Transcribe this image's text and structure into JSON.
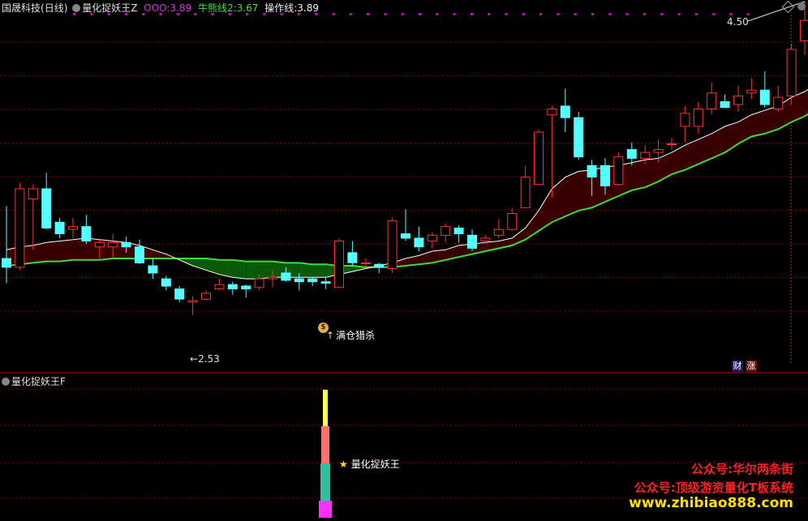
{
  "main_panel": {
    "stock_name": "国晟科技",
    "period": "(日线)",
    "indicator_name": "量化捉妖王Z",
    "line_ooo_label": "OOO:",
    "line_ooo_value": "3.89",
    "line_bull2_label": "牛熊线2:",
    "line_bull2_value": "3.67",
    "line_op_label": "操作线:",
    "line_op_value": "3.89",
    "high_label": "4.50",
    "low_label": "2.53",
    "signal_text": "满仓猎杀",
    "signal_icon": "money-bag-icon",
    "badge_cai": "财",
    "badge_zhang": "涨",
    "colors": {
      "up": "#ff3232",
      "down": "#54ffff",
      "ma_white": "#ffffff",
      "ma_green": "#3cdc3c",
      "fill_red": "#3a0000",
      "fill_green": "#0a5a0a",
      "grid": "#8b0000",
      "magenta": "#d000d0"
    }
  },
  "sub_panel": {
    "indicator_name": "量化捉妖王F",
    "signal_text": "量化捉妖王",
    "signal_icon": "star-icon"
  },
  "watermarks": {
    "line1": "公众号:华尔两条街",
    "line2": "公众号:顶级游资量化T板系统",
    "line3": "www.zhibiao888.com"
  },
  "chart_data": {
    "type": "candlestick",
    "ylim": [
      2.2,
      4.6
    ],
    "grid": true,
    "candles": [
      [
        2.92,
        2.86,
        3.28,
        2.75
      ],
      [
        2.86,
        3.4,
        3.44,
        2.84
      ],
      [
        3.33,
        3.4,
        3.43,
        2.98
      ],
      [
        3.4,
        3.13,
        3.51,
        3.12
      ],
      [
        3.17,
        3.09,
        3.2,
        3.06
      ],
      [
        3.12,
        3.14,
        3.2,
        3.06
      ],
      [
        3.14,
        3.04,
        3.22,
        3.02
      ],
      [
        3.0,
        3.03,
        3.05,
        2.92
      ],
      [
        3.0,
        3.03,
        3.09,
        2.92
      ],
      [
        3.03,
        3.0,
        3.07,
        2.96
      ],
      [
        3.0,
        2.89,
        3.05,
        2.88
      ],
      [
        2.87,
        2.82,
        2.92,
        2.78
      ],
      [
        2.78,
        2.73,
        2.8,
        2.7
      ],
      [
        2.71,
        2.64,
        2.73,
        2.62
      ],
      [
        2.62,
        2.63,
        2.66,
        2.53
      ],
      [
        2.64,
        2.68,
        2.7,
        2.63
      ],
      [
        2.71,
        2.74,
        2.78,
        2.7
      ],
      [
        2.74,
        2.71,
        2.76,
        2.67
      ],
      [
        2.73,
        2.71,
        2.74,
        2.65
      ],
      [
        2.72,
        2.78,
        2.81,
        2.7
      ],
      [
        2.78,
        2.79,
        2.84,
        2.72
      ],
      [
        2.82,
        2.77,
        2.86,
        2.76
      ],
      [
        2.78,
        2.76,
        2.82,
        2.7
      ],
      [
        2.78,
        2.76,
        2.79,
        2.73
      ],
      [
        2.76,
        2.75,
        2.79,
        2.71
      ],
      [
        2.72,
        3.04,
        3.06,
        2.72
      ],
      [
        2.96,
        2.89,
        3.04,
        2.87
      ],
      [
        2.89,
        2.89,
        2.92,
        2.86
      ],
      [
        2.88,
        2.86,
        2.89,
        2.82
      ],
      [
        2.85,
        3.18,
        3.2,
        2.82
      ],
      [
        3.09,
        3.06,
        3.26,
        3.04
      ],
      [
        3.06,
        3.0,
        3.14,
        2.97
      ],
      [
        3.04,
        3.08,
        3.1,
        2.99
      ],
      [
        3.08,
        3.14,
        3.16,
        3.03
      ],
      [
        3.13,
        3.09,
        3.15,
        3.03
      ],
      [
        3.08,
        2.99,
        3.12,
        2.97
      ],
      [
        3.04,
        3.06,
        3.08,
        3.02
      ],
      [
        3.08,
        3.12,
        3.19,
        3.06
      ],
      [
        3.12,
        3.23,
        3.27,
        3.11
      ],
      [
        3.27,
        3.48,
        3.56,
        3.27
      ],
      [
        3.43,
        3.79,
        3.81,
        3.43
      ],
      [
        3.91,
        3.95,
        3.97,
        3.34
      ],
      [
        3.97,
        3.89,
        4.09,
        3.79
      ],
      [
        3.89,
        3.62,
        3.93,
        3.6
      ],
      [
        3.56,
        3.48,
        3.6,
        3.35
      ],
      [
        3.56,
        3.42,
        3.61,
        3.36
      ],
      [
        3.43,
        3.62,
        3.65,
        3.42
      ],
      [
        3.67,
        3.61,
        3.72,
        3.56
      ],
      [
        3.61,
        3.65,
        3.7,
        3.57
      ],
      [
        3.65,
        3.67,
        3.74,
        3.58
      ],
      [
        3.71,
        3.71,
        3.75,
        3.67
      ],
      [
        3.83,
        3.92,
        3.97,
        3.72
      ],
      [
        3.83,
        3.95,
        4.0,
        3.78
      ],
      [
        3.95,
        4.06,
        4.13,
        3.91
      ],
      [
        4.0,
        3.96,
        4.05,
        3.96
      ],
      [
        3.98,
        4.04,
        4.11,
        3.93
      ],
      [
        4.06,
        4.08,
        4.16,
        4.02
      ],
      [
        4.08,
        3.98,
        4.21,
        3.96
      ],
      [
        3.95,
        4.03,
        4.11,
        3.93
      ],
      [
        4.04,
        4.36,
        4.4,
        3.98
      ],
      [
        4.42,
        4.56,
        4.69,
        4.32
      ],
      [
        4.27,
        4.24,
        4.36,
        4.11
      ],
      [
        4.24,
        4.2,
        4.27,
        4.17
      ],
      [
        4.23,
        4.3,
        4.32,
        4.15
      ]
    ],
    "ma_white": [
      2.98,
      3.0,
      3.01,
      3.03,
      3.04,
      3.05,
      3.06,
      3.05,
      3.04,
      3.03,
      3.01,
      2.98,
      2.95,
      2.91,
      2.87,
      2.84,
      2.81,
      2.79,
      2.78,
      2.78,
      2.79,
      2.79,
      2.79,
      2.79,
      2.79,
      2.81,
      2.83,
      2.85,
      2.87,
      2.89,
      2.92,
      2.94,
      2.97,
      2.98,
      3.01,
      3.02,
      3.03,
      3.04,
      3.06,
      3.13,
      3.25,
      3.4,
      3.48,
      3.52,
      3.53,
      3.55,
      3.56,
      3.58,
      3.6,
      3.61,
      3.65,
      3.7,
      3.74,
      3.78,
      3.83,
      3.86,
      3.91,
      3.94,
      3.97,
      4.03,
      4.07,
      4.13,
      4.17,
      4.2
    ],
    "ma_green": [
      2.87,
      2.88,
      2.89,
      2.9,
      2.9,
      2.91,
      2.91,
      2.91,
      2.92,
      2.92,
      2.92,
      2.92,
      2.92,
      2.92,
      2.92,
      2.92,
      2.91,
      2.91,
      2.9,
      2.9,
      2.9,
      2.89,
      2.89,
      2.88,
      2.88,
      2.87,
      2.87,
      2.86,
      2.86,
      2.86,
      2.87,
      2.88,
      2.89,
      2.91,
      2.93,
      2.95,
      2.97,
      2.99,
      3.01,
      3.05,
      3.11,
      3.17,
      3.21,
      3.25,
      3.27,
      3.31,
      3.35,
      3.39,
      3.41,
      3.45,
      3.5,
      3.53,
      3.57,
      3.61,
      3.65,
      3.71,
      3.76,
      3.78,
      3.81,
      3.86,
      3.9,
      3.96,
      4.01,
      4.05
    ]
  }
}
